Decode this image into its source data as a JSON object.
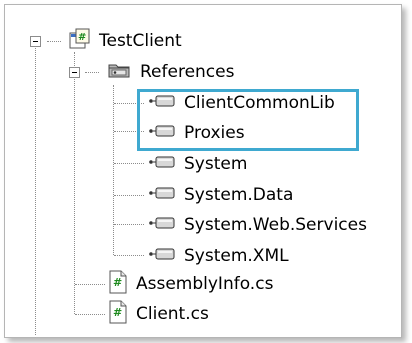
{
  "tree": {
    "project": {
      "label": "TestClient",
      "icon": "csharp-project-icon"
    },
    "references": {
      "label": "References",
      "icon": "references-folder-icon",
      "items": [
        {
          "label": "ClientCommonLib",
          "icon": "assembly-reference-icon",
          "highlighted": true
        },
        {
          "label": "Proxies",
          "icon": "assembly-reference-icon",
          "highlighted": true
        },
        {
          "label": "System",
          "icon": "assembly-reference-icon"
        },
        {
          "label": "System.Data",
          "icon": "assembly-reference-icon"
        },
        {
          "label": "System.Web.Services",
          "icon": "assembly-reference-icon"
        },
        {
          "label": "System.XML",
          "icon": "assembly-reference-icon"
        }
      ]
    },
    "files": [
      {
        "label": "AssemblyInfo.cs",
        "icon": "csharp-file-icon"
      },
      {
        "label": "Client.cs",
        "icon": "csharp-file-icon"
      }
    ]
  },
  "colors": {
    "highlight": "#3fa9d0",
    "tree_lines": "#8c8c8c"
  }
}
